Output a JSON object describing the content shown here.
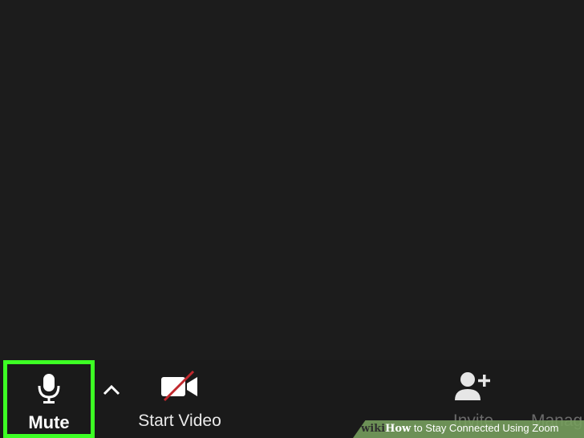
{
  "toolbar": {
    "mute_label": "Mute",
    "start_video_label": "Start Video",
    "invite_label": "Invite",
    "manage_label": "Manag"
  },
  "icons": {
    "mute": "microphone-icon",
    "caret": "chevron-up-icon",
    "video": "video-camera-off-icon",
    "invite": "add-person-icon"
  },
  "colors": {
    "highlight": "#3dff24",
    "background": "#1c1c1c",
    "video_slash": "#c0282d"
  },
  "watermark": {
    "brand_prefix": "wiki",
    "brand_suffix": "How",
    "title": " to Stay Connected Using Zoom"
  }
}
